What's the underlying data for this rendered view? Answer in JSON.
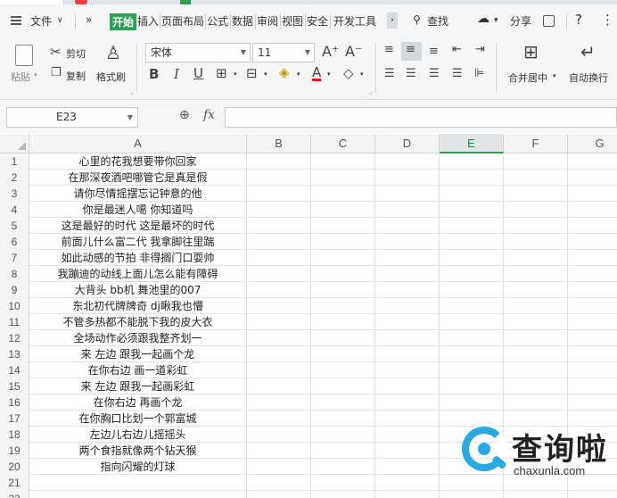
{
  "menu": {
    "file_label": "文件",
    "more": "»",
    "tabs": [
      "开始",
      "插入",
      "页面布局",
      "公式",
      "数据",
      "审阅",
      "视图",
      "安全",
      "开发工具"
    ],
    "search_label": "查找",
    "share_label": "分享",
    "help": "?",
    "more_dots": "⋮"
  },
  "ribbon": {
    "paste": "粘贴",
    "cut": "剪切",
    "copy": "复制",
    "format_painter": "格式刷",
    "font_name": "宋体",
    "font_size": "11",
    "merge_center": "合并居中",
    "wrap_text": "自动换行"
  },
  "formula_bar": {
    "cell_ref": "E23",
    "fx": "fx",
    "formula_value": ""
  },
  "grid": {
    "columns": [
      "A",
      "B",
      "C",
      "D",
      "E",
      "F",
      "G"
    ],
    "active_column": "E",
    "rows": [
      {
        "num": "1",
        "a": "心里的花我想要带你回家"
      },
      {
        "num": "2",
        "a": "在那深夜酒吧哪管它是真是假"
      },
      {
        "num": "3",
        "a": "请你尽情摇摆忘记钟意的他"
      },
      {
        "num": "4",
        "a": "你是最迷人噶 你知道吗"
      },
      {
        "num": "5",
        "a": "这是最好的时代 这是最坏的时代"
      },
      {
        "num": "6",
        "a": "前面儿什么富二代 我拿脚往里踹"
      },
      {
        "num": "7",
        "a": "如此动感的节拍 非得搁门口耍帅"
      },
      {
        "num": "8",
        "a": "我蹦迪的动线上面儿怎么能有障碍"
      },
      {
        "num": "9",
        "a": "大背头 bb机 舞池里的007"
      },
      {
        "num": "10",
        "a": "东北初代牌牌奇 dj瞅我也懵"
      },
      {
        "num": "11",
        "a": "不管多热都不能脱下我的皮大衣"
      },
      {
        "num": "12",
        "a": "全场动作必须跟我整齐划一"
      },
      {
        "num": "13",
        "a": "来 左边 跟我一起画个龙"
      },
      {
        "num": "14",
        "a": "在你右边 画一道彩虹"
      },
      {
        "num": "15",
        "a": "来 左边 跟我一起画彩虹"
      },
      {
        "num": "16",
        "a": "在你右边 再画个龙"
      },
      {
        "num": "17",
        "a": "在你胸口比划一个郭富城"
      },
      {
        "num": "18",
        "a": "左边儿右边儿摇摇头"
      },
      {
        "num": "19",
        "a": "两个食指就像两个钻天猴"
      },
      {
        "num": "20",
        "a": "指向闪耀的灯球"
      },
      {
        "num": "21",
        "a": ""
      },
      {
        "num": "22",
        "a": ""
      }
    ]
  },
  "watermark": {
    "brand": "查询啦",
    "url": "chaxunla.com"
  },
  "colors": {
    "accent": "#2ea055",
    "watermark_blue": "#2aa8e0"
  }
}
